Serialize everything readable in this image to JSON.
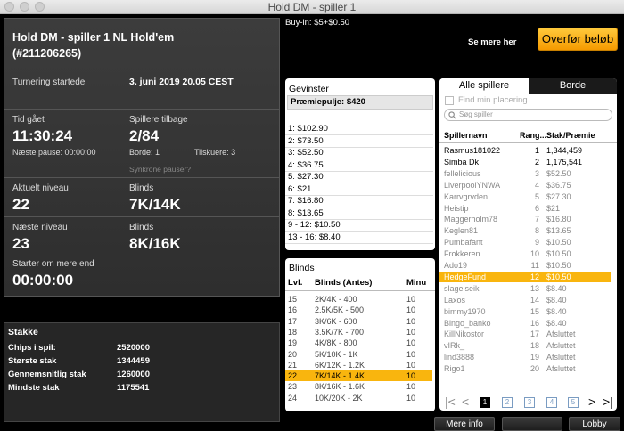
{
  "window": {
    "title": "Hold DM - spiller 1"
  },
  "tournament": {
    "name": "Hold DM - spiller 1 NL Hold'em",
    "id": "(#211206265)",
    "started_label": "Turnering startede",
    "started_value": "3. juni 2019 20.05 CEST",
    "elapsed_label": "Tid gået",
    "elapsed_value": "11:30:24",
    "players_left_label": "Spillere tilbage",
    "players_left_value": "2/84",
    "next_break": "Næste pause: 00:00:00",
    "table": "Borde: 1",
    "spectators": "Tilskuere: 3",
    "sync_breaks": "Synkrone pauser?",
    "current_level_label": "Aktuelt niveau",
    "current_level_value": "22",
    "blinds_label": "Blinds",
    "current_blinds": "7K/14K",
    "next_level_label": "Næste niveau",
    "next_level_value": "23",
    "next_blinds": "8K/16K",
    "starts_in_label": "Starter om mere end",
    "starts_in_value": "00:00:00"
  },
  "buyin": "Buy-in: $5+$0.50",
  "see_more": "Se mere her",
  "transfer_button": "Overfør beløb",
  "stacks": {
    "title": "Stakke",
    "rows": [
      {
        "label": "Chips i spil:",
        "value": "2520000"
      },
      {
        "label": "Største stak",
        "value": "1344459"
      },
      {
        "label": "Gennemsnitlig stak",
        "value": "1260000"
      },
      {
        "label": "Mindste stak",
        "value": "1175541"
      }
    ]
  },
  "prizes": {
    "title": "Gevinster",
    "pool": "Præmiepulje: $420",
    "rows": [
      "1: $102.90",
      "2: $73.50",
      "3: $52.50",
      "4: $36.75",
      "5: $27.30",
      "6: $21",
      "7: $16.80",
      "8: $13.65",
      "9 - 12: $10.50",
      "13 - 16: $8.40"
    ]
  },
  "blinds": {
    "title": "Blinds",
    "headers": [
      "Lvl.",
      "Blinds (Antes)",
      "Minu"
    ],
    "rows": [
      [
        "15",
        "2K/4K - 400",
        "10"
      ],
      [
        "16",
        "2.5K/5K - 500",
        "10"
      ],
      [
        "17",
        "3K/6K - 600",
        "10"
      ],
      [
        "18",
        "3.5K/7K - 700",
        "10"
      ],
      [
        "19",
        "4K/8K - 800",
        "10"
      ],
      [
        "20",
        "5K/10K - 1K",
        "10"
      ],
      [
        "21",
        "6K/12K - 1.2K",
        "10"
      ],
      [
        "22",
        "7K/14K - 1.4K",
        "10"
      ],
      [
        "23",
        "8K/16K - 1.6K",
        "10"
      ],
      [
        "24",
        "10K/20K - 2K",
        "10"
      ]
    ]
  },
  "players": {
    "tab_all": "Alle spillere",
    "tab_tables": "Borde",
    "find_my_placing": "Find min placering",
    "search_placeholder": "Søg spiller",
    "headers": [
      "Spillernavn",
      "Rang...",
      "Stak/Præmie"
    ],
    "rows": [
      [
        "Rasmus181022",
        "1",
        "1,344,459"
      ],
      [
        "Simba Dk",
        "2",
        "1,175,541"
      ],
      [
        "fellelicious",
        "3",
        "$52.50"
      ],
      [
        "LiverpoolYNWA",
        "4",
        "$36.75"
      ],
      [
        "Karrvgrvden",
        "5",
        "$27.30"
      ],
      [
        "Heistip",
        "6",
        "$21"
      ],
      [
        "Maggerholm78",
        "7",
        "$16.80"
      ],
      [
        "Keglen81",
        "8",
        "$13.65"
      ],
      [
        "Pumbafant",
        "9",
        "$10.50"
      ],
      [
        "Frokkeren",
        "10",
        "$10.50"
      ],
      [
        "Ado19",
        "11",
        "$10.50"
      ],
      [
        "HedgeFund",
        "12",
        "$10.50"
      ],
      [
        "slagelseik",
        "13",
        "$8.40"
      ],
      [
        "Laxos",
        "14",
        "$8.40"
      ],
      [
        "bimmy1970",
        "15",
        "$8.40"
      ],
      [
        "Bingo_banko",
        "16",
        "$8.40"
      ],
      [
        "KillNikostor",
        "17",
        "Afsluttet"
      ],
      [
        "vIRk_",
        "18",
        "Afsluttet"
      ],
      [
        "lind3888",
        "19",
        "Afsluttet"
      ],
      [
        "Rigo1",
        "20",
        "Afsluttet"
      ]
    ],
    "pages": [
      "1",
      "2",
      "3",
      "4",
      "5"
    ]
  },
  "bottom": {
    "more_info": "Mere info",
    "lobby": "Lobby"
  },
  "colors": {
    "accent": "#f9b50e"
  }
}
